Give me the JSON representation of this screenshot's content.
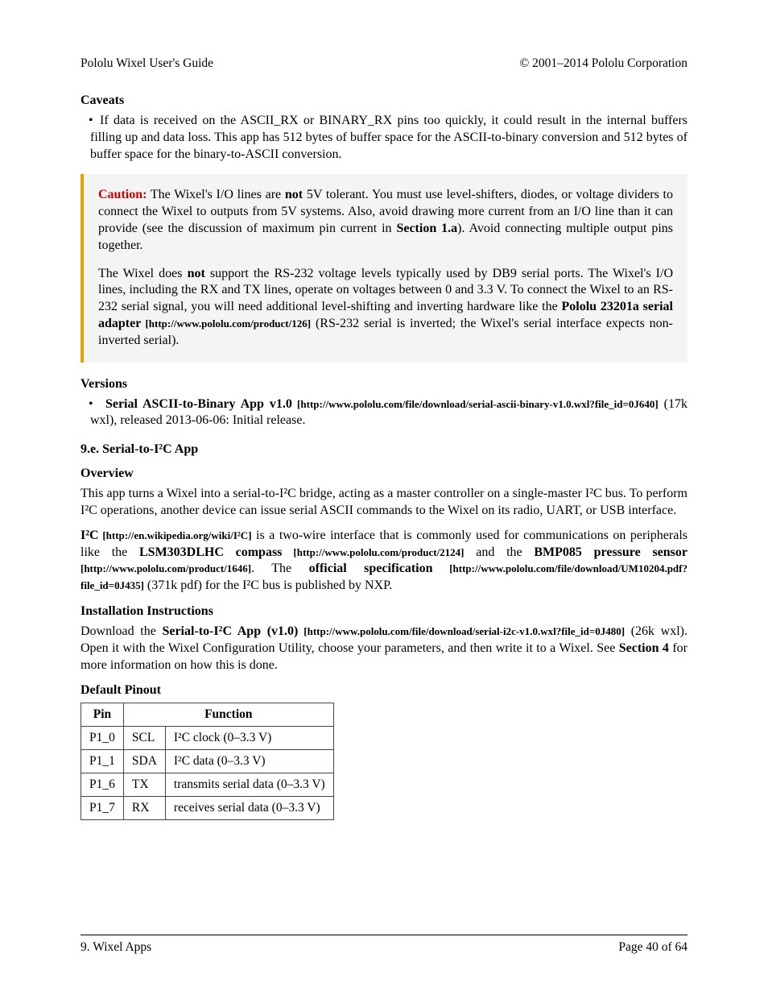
{
  "header": {
    "left": "Pololu Wixel User's Guide",
    "right": "© 2001–2014 Pololu Corporation"
  },
  "caveats": {
    "heading": "Caveats",
    "bullet_prefix": "If data is received on the ASCII_RX or BINARY_RX pins too quickly, it could result in the internal buffers filling up and data loss. This app has 512 bytes of buffer space for the ASCII-to-binary conversion and 512 bytes of buffer space for the binary-to-ASCII conversion."
  },
  "callout": {
    "caution_label": "Caution:",
    "p1_a": " The Wixel's I/O lines are ",
    "p1_not": "not",
    "p1_b": " 5V tolerant. You must use level-shifters, diodes, or voltage dividers to connect the Wixel to outputs from 5V systems. Also, avoid drawing more current from an I/O line than it can provide (see the discussion of maximum pin current in ",
    "p1_sec": "Section 1.a",
    "p1_c": "). Avoid connecting multiple output pins together.",
    "p2_a": "The Wixel does ",
    "p2_not": "not",
    "p2_b": " support the RS-232 voltage levels typically used by DB9 serial ports. The Wixel's I/O lines, including the RX and TX lines, operate on voltages between 0 and 3.3 V. To connect the Wixel to an RS-232 serial signal, you will need additional level-shifting and inverting hardware like the ",
    "p2_link_text": "Pololu 23201a serial adapter",
    "p2_link_url": " [http://www.pololu.com/product/126]",
    "p2_c": " (RS-232 serial is inverted; the Wixel's serial interface expects non-inverted serial)."
  },
  "versions": {
    "heading": "Versions",
    "item_name": "Serial ASCII-to-Binary App v1.0",
    "item_url": " [http://www.pololu.com/file/download/serial-ascii-binary-v1.0.wxl?file_id=0J640]",
    "item_tail": " (17k wxl), released 2013-06-06: Initial release."
  },
  "sec9e": {
    "heading": "9.e. Serial-to-I²C App",
    "overview_heading": "Overview",
    "overview_p1": "This app turns a Wixel into a serial-to-I²C bridge, acting as a master controller on a single-master I²C bus. To perform I²C operations, another device can issue serial ASCII commands to the Wixel on its radio, UART, or USB interface.",
    "p2_i2c": "I²C",
    "p2_i2c_url": " [http://en.wikipedia.org/wiki/I²C]",
    "p2_a": " is a two-wire interface that is commonly used for communications on peripherals like the ",
    "p2_lsm": "LSM303DLHC compass",
    "p2_lsm_url": " [http://www.pololu.com/product/2124]",
    "p2_b": " and the ",
    "p2_bmp": "BMP085 pressure sensor",
    "p2_bmp_url": " [http://www.pololu.com/product/1646]",
    "p2_c": ". The ",
    "p2_spec": "official specification",
    "p2_spec_url": " [http://www.pololu.com/file/download/UM10204.pdf?file_id=0J435]",
    "p2_d": " (371k pdf) for the I²C bus is published by NXP.",
    "install_heading": "Installation Instructions",
    "install_a": "Download the ",
    "install_link": "Serial-to-I²C App (v1.0)",
    "install_url": " [http://www.pololu.com/file/download/serial-i2c-v1.0.wxl?file_id=0J480]",
    "install_b": " (26k wxl). Open it with the Wixel Configuration Utility, choose your parameters, and then write it to a Wixel. See ",
    "install_sec": "Section 4",
    "install_c": " for more information on how this is done.",
    "pinout_heading": "Default Pinout"
  },
  "pinout": {
    "th_pin": "Pin",
    "th_func": "Function",
    "rows": [
      {
        "pin": "P1_0",
        "sig": "SCL",
        "desc": "I²C clock (0–3.3 V)"
      },
      {
        "pin": "P1_1",
        "sig": "SDA",
        "desc": "I²C data (0–3.3 V)"
      },
      {
        "pin": "P1_6",
        "sig": "TX",
        "desc": "transmits serial data (0–3.3 V)"
      },
      {
        "pin": "P1_7",
        "sig": "RX",
        "desc": "receives serial data (0–3.3 V)"
      }
    ]
  },
  "footer": {
    "left": "9. Wixel Apps",
    "right": "Page 40 of 64"
  }
}
